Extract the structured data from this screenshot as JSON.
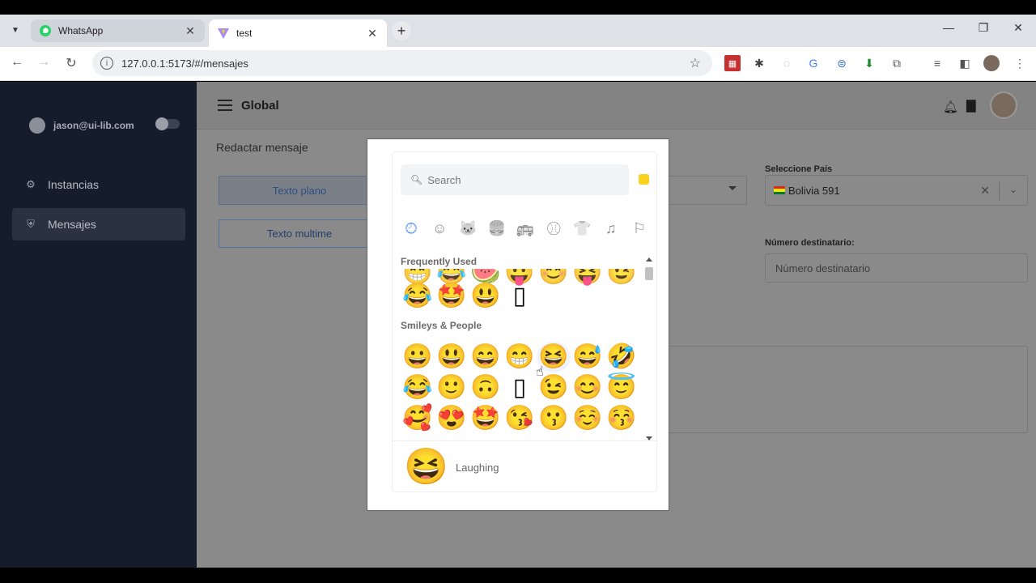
{
  "browser": {
    "tabs": [
      {
        "title": "WhatsApp",
        "icon": "whatsapp-icon"
      },
      {
        "title": "test",
        "icon": "vite-icon"
      }
    ],
    "url": "127.0.0.1:5173/#/mensajes"
  },
  "sidebar": {
    "user_email": "jason@ui-lib.com",
    "items": [
      {
        "label": "Instancias",
        "icon": "gear-icon"
      },
      {
        "label": "Mensajes",
        "icon": "shield-icon"
      }
    ]
  },
  "header": {
    "title": "Global"
  },
  "page": {
    "subtitle": "Redactar mensaje",
    "btn_plain": "Texto plano",
    "btn_multimedia": "Texto multime"
  },
  "form": {
    "country_label": "Seleccione País",
    "country_value": "Bolivia 591",
    "number_label": "Número destinatario:",
    "number_placeholder": "Número destinatario"
  },
  "emoji_picker": {
    "search_placeholder": "Search",
    "section_frequent": "Frequently Used",
    "section_smileys": "Smileys & People",
    "frequent_row_partial": [
      "😁",
      "😂",
      "🍉",
      "😛",
      "😊",
      "😝",
      "😉"
    ],
    "frequent_row": [
      "😂",
      "🤩",
      "😃",
      "▯"
    ],
    "smileys_rows": [
      [
        "😀",
        "😃",
        "😄",
        "😁",
        "😆",
        "😅",
        "🤣"
      ],
      [
        "😂",
        "🙂",
        "🙃",
        "▯",
        "😉",
        "😊",
        "😇"
      ],
      [
        "🥰",
        "😍",
        "🤩",
        "😘",
        "😗",
        "☺️",
        "😚"
      ]
    ],
    "preview_emoji": "😆",
    "preview_name": "Laughing"
  },
  "colors": {
    "sidebar": "#151d2c",
    "accent": "#3b82f6",
    "skin_tone": "#fbd120"
  }
}
